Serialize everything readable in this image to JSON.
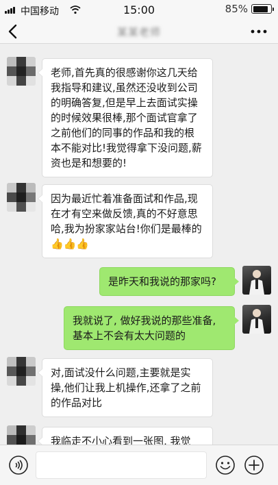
{
  "status_bar": {
    "carrier": "中国移动",
    "time": "15:00",
    "battery": "85%",
    "battery_level": 0.85
  },
  "nav": {
    "title": "某某老师",
    "back_icon": "chevron-left-icon",
    "more_icon": "more-dots-icon"
  },
  "messages": [
    {
      "side": "left",
      "text": "老师,首先真的很感谢你这几天给我指导和建议,虽然还没收到公司的明确答复,但是早上去面试实操的时候效果很棒,那个面试官拿了之前他们的同事的作品和我的根本不能对比!我觉得拿下没问题,薪资也是和想要的!"
    },
    {
      "side": "left",
      "text": "因为最近忙着准备面试和作品,现在才有空来做反馈,真的不好意思哈,我为扮家家站台!你们是最棒的",
      "emoji": "👍👍👍"
    },
    {
      "side": "right",
      "text": "是昨天和我说的那家吗?"
    },
    {
      "side": "right",
      "text": "我就说了, 做好我说的那些准备, 基本上不会有太大问题的"
    },
    {
      "side": "left",
      "text": "对,面试没什么问题,主要就是实操,他们让我上机操作,还拿了之前的作品对比"
    },
    {
      "side": "left",
      "text": "我临走不小心看到一张图, 我觉"
    }
  ],
  "input_bar": {
    "voice_icon": "voice-icon",
    "emoji_icon": "emoji-icon",
    "plus_icon": "plus-icon",
    "placeholder": ""
  },
  "colors": {
    "chat_bg": "#efefef",
    "bubble_right": "#9fe870",
    "bubble_left": "#ffffff"
  }
}
